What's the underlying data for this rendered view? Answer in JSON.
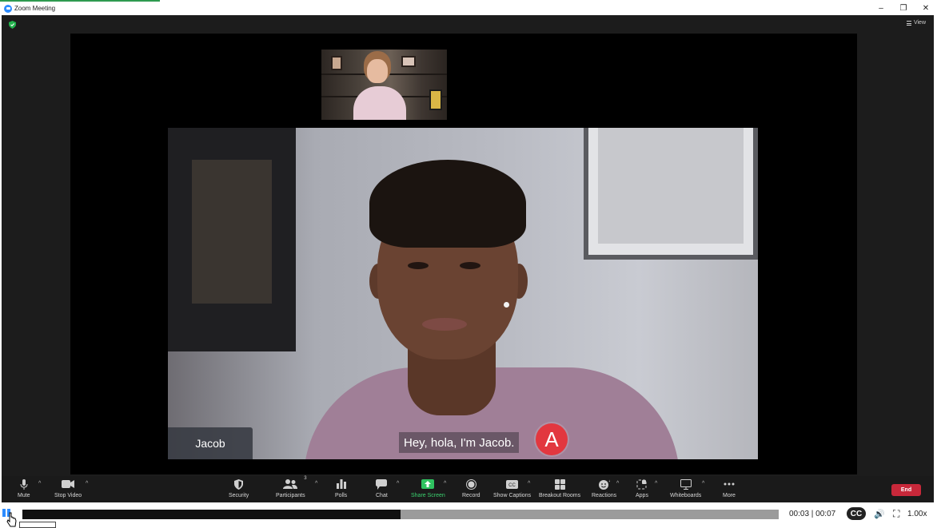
{
  "window": {
    "title": "Zoom Meeting",
    "minimize": "–",
    "restore": "❐",
    "close": "✕",
    "accent_color": "#2e9a4f"
  },
  "meeting": {
    "view_label": "View",
    "main_participant_name": "Jacob",
    "caption_text": "Hey, hola, I'm Jacob.",
    "marker_label": "A",
    "marker_color": "#e2373f"
  },
  "toolbar": {
    "mute": "Mute",
    "stop_video": "Stop Video",
    "security": "Security",
    "participants": "Participants",
    "participants_count": "3",
    "polls": "Polls",
    "chat": "Chat",
    "share_screen": "Share Screen",
    "record": "Record",
    "show_captions": "Show Captions",
    "breakout_rooms": "Breakout Rooms",
    "reactions": "Reactions",
    "apps": "Apps",
    "whiteboards": "Whiteboards",
    "more": "More",
    "end": "End",
    "share_color": "#3bd16f",
    "end_color": "#c8283a"
  },
  "player": {
    "time_current": "00:03",
    "time_total": "00:07",
    "time_display": "00:03 | 00:07",
    "progress": 0.5,
    "cc_label": "CC",
    "speed": "1.00x",
    "accent_color": "#2d8cff"
  }
}
